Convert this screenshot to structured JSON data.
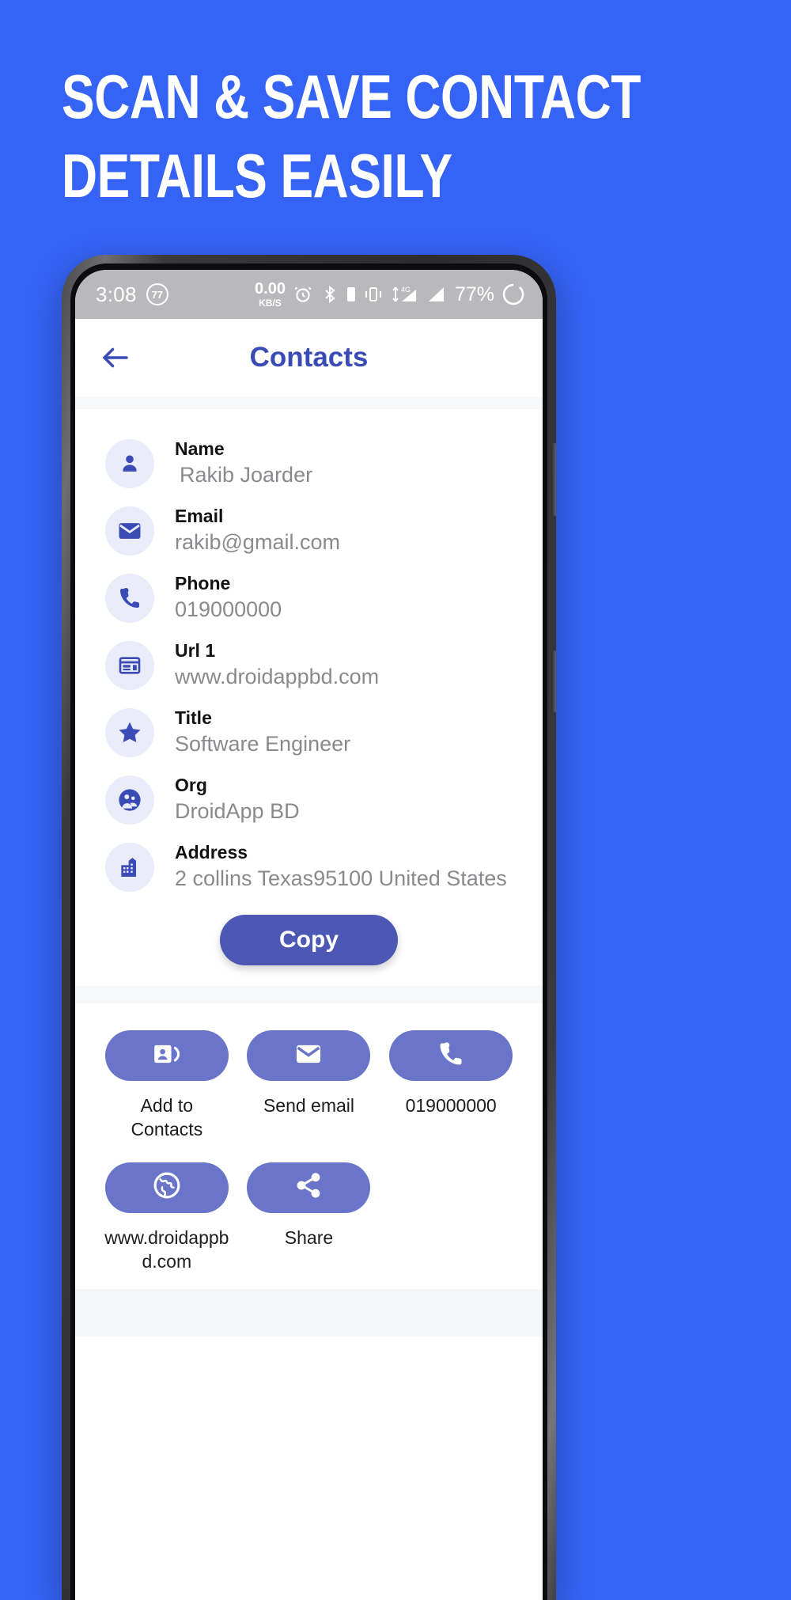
{
  "promo": {
    "line1": "Scan & Save Contact",
    "line2": "Details Easily",
    "bg_color": "#3563f5"
  },
  "status_bar": {
    "time": "3:08",
    "badge": "77",
    "net_speed_value": "0.00",
    "net_speed_unit": "KB/S",
    "network": "4G",
    "battery_percent": "77%",
    "icons": [
      "alarm-icon",
      "bluetooth-icon",
      "vibrate-icon",
      "signal-4g-icon",
      "signal-icon",
      "battery-circle-icon"
    ]
  },
  "appbar": {
    "title": "Contacts",
    "back_icon": "back-arrow-icon"
  },
  "contact": {
    "rows": [
      {
        "icon": "person-icon",
        "label": "Name",
        "value": "Rakib Joarder"
      },
      {
        "icon": "email-icon",
        "label": "Email",
        "value": "rakib@gmail.com"
      },
      {
        "icon": "phone-icon",
        "label": "Phone",
        "value": "019000000"
      },
      {
        "icon": "web-card-icon",
        "label": "Url 1",
        "value": "www.droidappbd.com"
      },
      {
        "icon": "star-icon",
        "label": "Title",
        "value": "Software Engineer"
      },
      {
        "icon": "group-icon",
        "label": "Org",
        "value": "DroidApp BD"
      },
      {
        "icon": "building-icon",
        "label": "Address",
        "value": "2 collins Texas95100 United States"
      }
    ],
    "copy_label": "Copy"
  },
  "actions": [
    {
      "icon": "add-contact-icon",
      "label": "Add to Contacts"
    },
    {
      "icon": "email-icon",
      "label": "Send email"
    },
    {
      "icon": "phone-icon",
      "label": "019000000"
    },
    {
      "icon": "globe-icon",
      "label": "www.droidappbd.com"
    },
    {
      "icon": "share-icon",
      "label": "Share"
    }
  ],
  "colors": {
    "brand_blue": "#3563f5",
    "title_indigo": "#3b4bb5",
    "copy_button": "#4d58b5",
    "action_pill": "#6a75c9",
    "icon_bubble": "#eaedf9"
  }
}
